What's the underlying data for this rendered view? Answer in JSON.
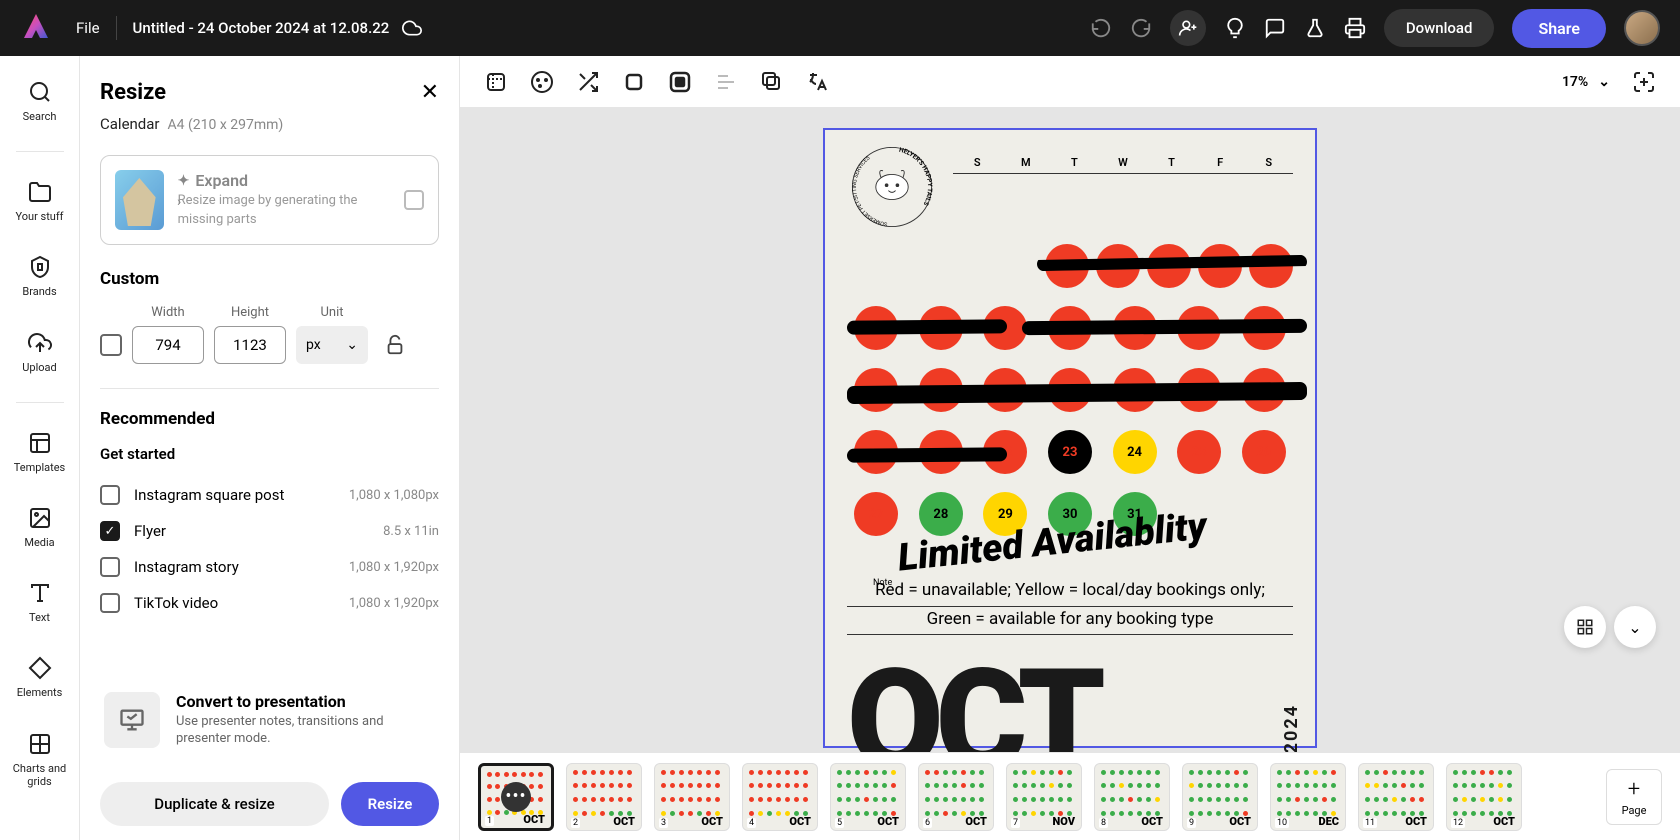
{
  "topbar": {
    "file": "File",
    "title": "Untitled - 24 October 2024 at 12.08.22",
    "download": "Download",
    "share": "Share"
  },
  "rail": [
    {
      "label": "Search",
      "icon": "search"
    },
    {
      "label": "Your stuff",
      "icon": "folder"
    },
    {
      "label": "Brands",
      "icon": "brand"
    },
    {
      "label": "Upload",
      "icon": "upload"
    },
    {
      "label": "Templates",
      "icon": "templates"
    },
    {
      "label": "Media",
      "icon": "media"
    },
    {
      "label": "Text",
      "icon": "text"
    },
    {
      "label": "Elements",
      "icon": "elements"
    },
    {
      "label": "Charts and grids",
      "icon": "charts"
    }
  ],
  "panel": {
    "title": "Resize",
    "subtitle": "Calendar",
    "dims": "A4 (210 x 297mm)",
    "expand": {
      "title": "Expand",
      "desc": "Resize image by generating the missing parts"
    },
    "custom": {
      "title": "Custom",
      "width_lbl": "Width",
      "height_lbl": "Height",
      "unit_lbl": "Unit",
      "width": "794",
      "height": "1123",
      "unit": "px"
    },
    "rec_title": "Recommended",
    "get_started": "Get started",
    "sizes": [
      {
        "name": "Instagram square post",
        "dim": "1,080 x 1,080px",
        "on": false
      },
      {
        "name": "Flyer",
        "dim": "8.5 x 11in",
        "on": true
      },
      {
        "name": "Instagram story",
        "dim": "1,080 x 1,920px",
        "on": false
      },
      {
        "name": "TikTok video",
        "dim": "1,080 x 1,920px",
        "on": false
      }
    ],
    "convert": {
      "title": "Convert to presentation",
      "desc": "Use presenter notes, transitions and presenter mode."
    },
    "dup": "Duplicate & resize",
    "resize": "Resize"
  },
  "canvas": {
    "zoom": "17%",
    "days": [
      "S",
      "M",
      "T",
      "W",
      "T",
      "F",
      "S"
    ],
    "note_label": "Note",
    "headline": "Limited Availablity",
    "legend1": "Red = unavailable; Yellow = local/day bookings only;",
    "legend2": "Green = available for any booking type",
    "month": "OCT",
    "year": "2024",
    "badge": "HELYER'S HAPPY TAILS SOMERSET PET-SITTING SERVICES"
  },
  "thumbs": [
    {
      "n": "1",
      "mo": "OCT"
    },
    {
      "n": "2",
      "mo": "OCT"
    },
    {
      "n": "3",
      "mo": "OCT"
    },
    {
      "n": "4",
      "mo": "OCT"
    },
    {
      "n": "5",
      "mo": "OCT"
    },
    {
      "n": "6",
      "mo": "OCT"
    },
    {
      "n": "7",
      "mo": "NOV"
    },
    {
      "n": "8",
      "mo": "OCT"
    },
    {
      "n": "9",
      "mo": "OCT"
    },
    {
      "n": "10",
      "mo": "DEC"
    },
    {
      "n": "11",
      "mo": "OCT"
    },
    {
      "n": "12",
      "mo": "OCT"
    }
  ],
  "add_page": "Page"
}
